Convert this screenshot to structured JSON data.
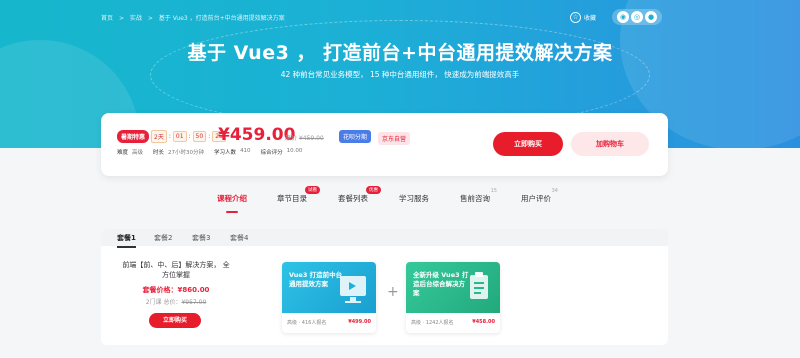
{
  "breadcrumb": [
    "首页",
    ">",
    "实战",
    ">",
    "基于 Vue3 ，打造前台+中台通用提效解决方案"
  ],
  "header": {
    "favorite_label": "收藏",
    "favorite_icon": "star-outline-icon"
  },
  "hero": {
    "title": "基于 Vue3 ， 打造前台+中台通用提效解决方案",
    "subtitle": "42 种前台常见业务模型， 15 种中台通用组件， 快速成为前端提效高手"
  },
  "buy": {
    "promo_tag": "暑期特惠",
    "countdown": [
      "2天",
      "01",
      "50",
      "25"
    ],
    "countdown_sep": ":",
    "price": "¥459.00",
    "old_price_label": "原价",
    "old_price": "¥459.00",
    "badge_installment": "花呗分期",
    "badge_jd": "京东自营",
    "meta": {
      "difficulty_label": "难度",
      "difficulty": "高级",
      "duration_label": "时长",
      "duration": "27小时30分钟",
      "students_label": "学习人数",
      "students": "410",
      "rating_label": "综合评分",
      "rating": "10.00"
    },
    "buy_label": "立即购买",
    "cart_label": "加购物车"
  },
  "tabs": [
    {
      "label": "课程介绍",
      "active": true
    },
    {
      "label": "章节目录",
      "badge": "试看"
    },
    {
      "label": "套餐列表",
      "badge": "优惠"
    },
    {
      "label": "学习服务"
    },
    {
      "label": "售前咨询",
      "sup": "15"
    },
    {
      "label": "用户评价",
      "sup": "34"
    }
  ],
  "packages": {
    "tabs": [
      "套餐1",
      "套餐2",
      "套餐3",
      "套餐4"
    ],
    "desc": "前端【前、中、后】解决方案， 全方位掌握",
    "price_label": "套餐价格：",
    "price": "¥860.00",
    "total_label": "2门课 总价：",
    "total": "¥957.00",
    "buy_label": "立即购买",
    "plus": "+",
    "courses": [
      {
        "title": "Vue3 打造前中台通用提效方案",
        "level": "高级",
        "enrolled": "· 416人报名",
        "price": "¥499.00",
        "color": "#1fb0d8"
      },
      {
        "title": "全新升级 Vue3 打造后台综合解决方案",
        "level": "高级",
        "enrolled": "· 1242人报名",
        "price": "¥458.00",
        "color": "#28b98a"
      }
    ]
  },
  "colors": {
    "accent": "#e8213b",
    "hero_start": "#16b7cc",
    "hero_end": "#2b8fe0"
  }
}
